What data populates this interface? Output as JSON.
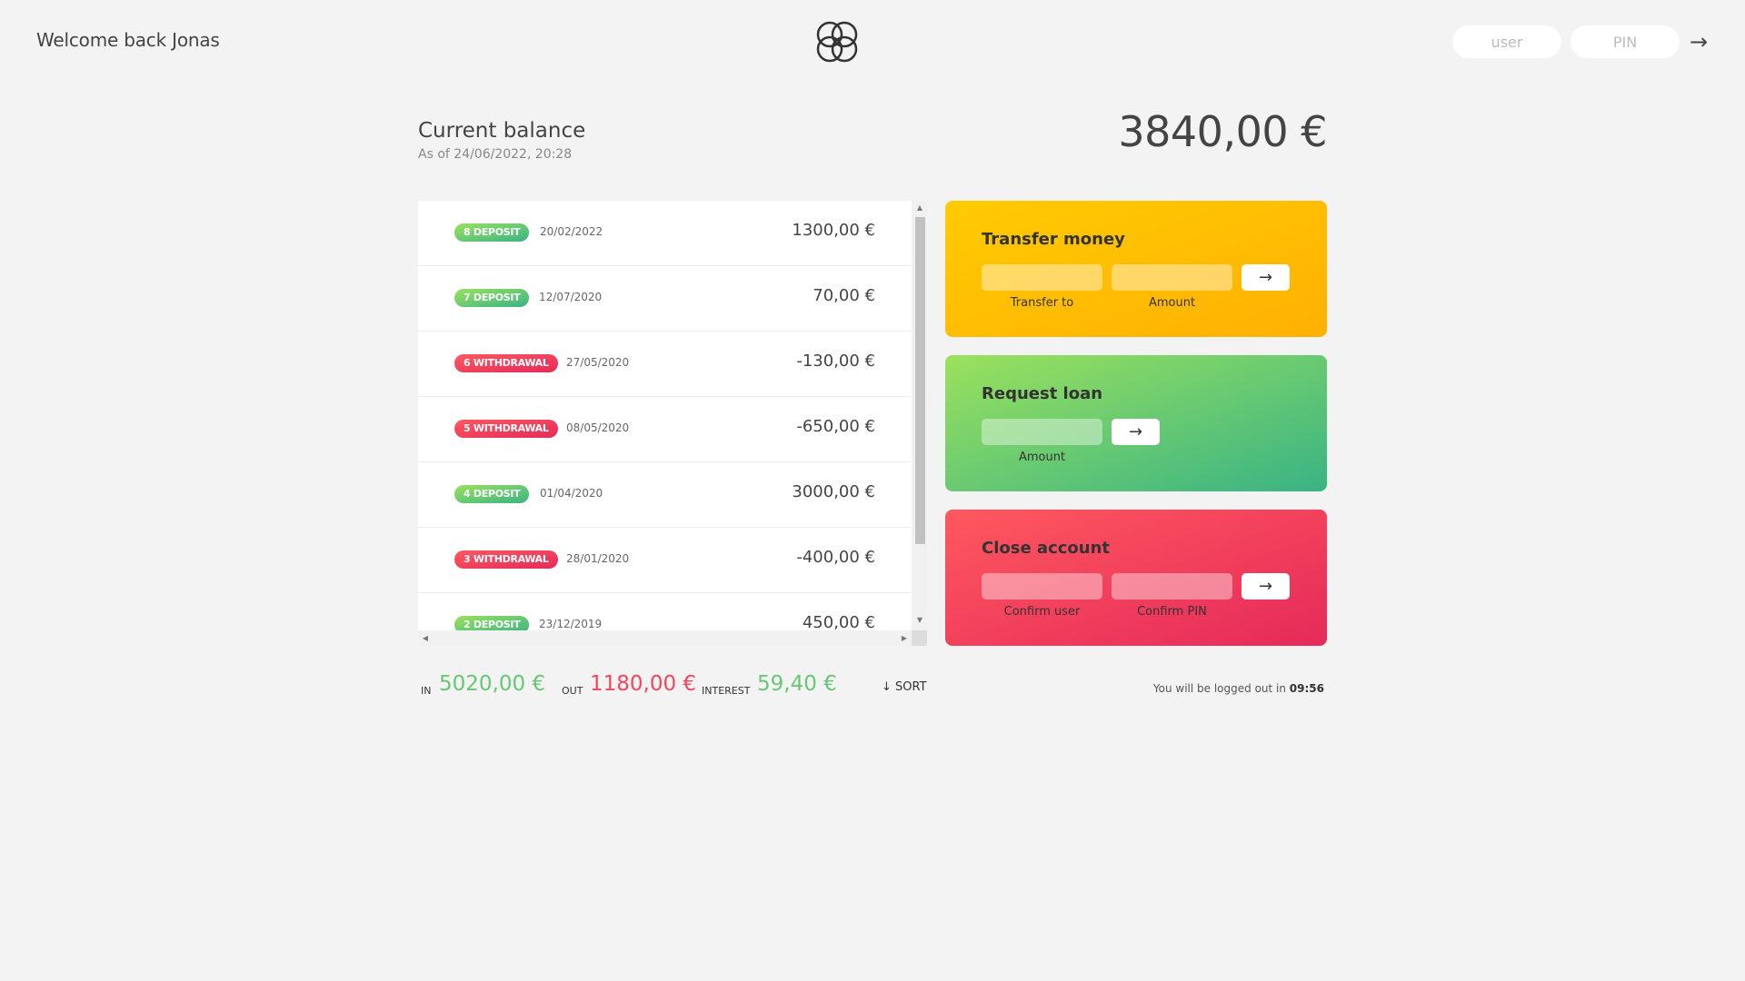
{
  "nav": {
    "welcome": "Welcome back Jonas",
    "login_user_placeholder": "user",
    "login_pin_placeholder": "PIN",
    "login_button": "→"
  },
  "balance": {
    "label": "Current balance",
    "date": "As of 24/06/2022, 20:28",
    "value": "3840,00 €"
  },
  "movements": [
    {
      "type_label": "8 deposit",
      "kind": "deposit",
      "date": "20/02/2022",
      "value": "1300,00 €"
    },
    {
      "type_label": "7 deposit",
      "kind": "deposit",
      "date": "12/07/2020",
      "value": "70,00 €"
    },
    {
      "type_label": "6 withdrawal",
      "kind": "withdrawal",
      "date": "27/05/2020",
      "value": "-130,00 €"
    },
    {
      "type_label": "5 withdrawal",
      "kind": "withdrawal",
      "date": "08/05/2020",
      "value": "-650,00 €"
    },
    {
      "type_label": "4 deposit",
      "kind": "deposit",
      "date": "01/04/2020",
      "value": "3000,00 €"
    },
    {
      "type_label": "3 withdrawal",
      "kind": "withdrawal",
      "date": "28/01/2020",
      "value": "-400,00 €"
    },
    {
      "type_label": "2 deposit",
      "kind": "deposit",
      "date": "23/12/2019",
      "value": "450,00 €"
    }
  ],
  "operations": {
    "transfer": {
      "title": "Transfer money",
      "to_label": "Transfer to",
      "amount_label": "Amount",
      "button": "→"
    },
    "loan": {
      "title": "Request loan",
      "amount_label": "Amount",
      "button": "→"
    },
    "close": {
      "title": "Close account",
      "user_label": "Confirm user",
      "pin_label": "Confirm PIN",
      "button": "→"
    }
  },
  "summary": {
    "in_label": "In",
    "in_value": "5020,00 €",
    "out_label": "Out",
    "out_value": "1180,00 €",
    "interest_label": "Interest",
    "interest_value": "59,40 €",
    "sort_label": "↓ SORT"
  },
  "logout": {
    "text": "You will be logged out in ",
    "timer": "09:56"
  },
  "colors": {
    "background": "#f3f3f3",
    "deposit": "#66c873",
    "withdrawal": "#f5465d",
    "transfer_card": "#ffcb03",
    "loan_card": "#9be15d",
    "close_card": "#ff585f"
  }
}
